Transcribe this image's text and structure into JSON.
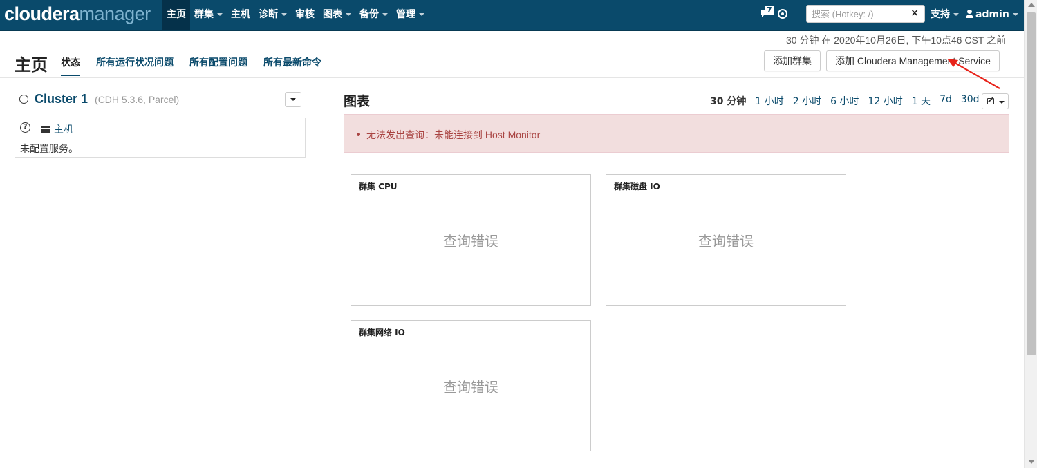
{
  "nav": {
    "logo_primary": "cloudera",
    "logo_secondary": "manager",
    "items": [
      {
        "label": "主页",
        "dropdown": false,
        "active": true
      },
      {
        "label": "群集",
        "dropdown": true
      },
      {
        "label": "主机",
        "dropdown": false
      },
      {
        "label": "诊断",
        "dropdown": true
      },
      {
        "label": "审核",
        "dropdown": false
      },
      {
        "label": "图表",
        "dropdown": true
      },
      {
        "label": "备份",
        "dropdown": true
      },
      {
        "label": "管理",
        "dropdown": true
      }
    ],
    "notification_count": "7",
    "search_placeholder": "搜索 (Hotkey: /)",
    "clear_icon": "×",
    "support_label": "支持",
    "user_label": "admin"
  },
  "header": {
    "timestamp": "30 分钟 在 2020年10月26日, 下午10点46 CST 之前",
    "page_title": "主页",
    "tabs": [
      "状态",
      "所有运行状况问题",
      "所有配置问题",
      "所有最新命令"
    ],
    "add_cluster_label": "添加群集",
    "add_mgmt_label": "添加 Cloudera Management Service"
  },
  "cluster": {
    "name": "Cluster 1",
    "version": "(CDH 5.3.6, Parcel)",
    "help_icon": "?",
    "hosts_label": "主机",
    "no_services": "未配置服务。"
  },
  "charts": {
    "title": "图表",
    "ranges": [
      "30 分钟",
      "1 小时",
      "2 小时",
      "6 小时",
      "12 小时",
      "1 天",
      "7d",
      "30d"
    ],
    "alert": "无法发出查询：未能连接到 Host Monitor",
    "cards": [
      {
        "title": "群集 CPU",
        "error": "查询错误"
      },
      {
        "title": "群集磁盘 IO",
        "error": "查询错误"
      },
      {
        "title": "群集网络 IO",
        "error": "查询错误"
      }
    ]
  },
  "colors": {
    "nav_bg": "#0a4a6b",
    "link": "#0a4a6b",
    "alert_bg": "#f2dede",
    "alert_text": "#a94442",
    "annotation_arrow": "#e8231a"
  }
}
